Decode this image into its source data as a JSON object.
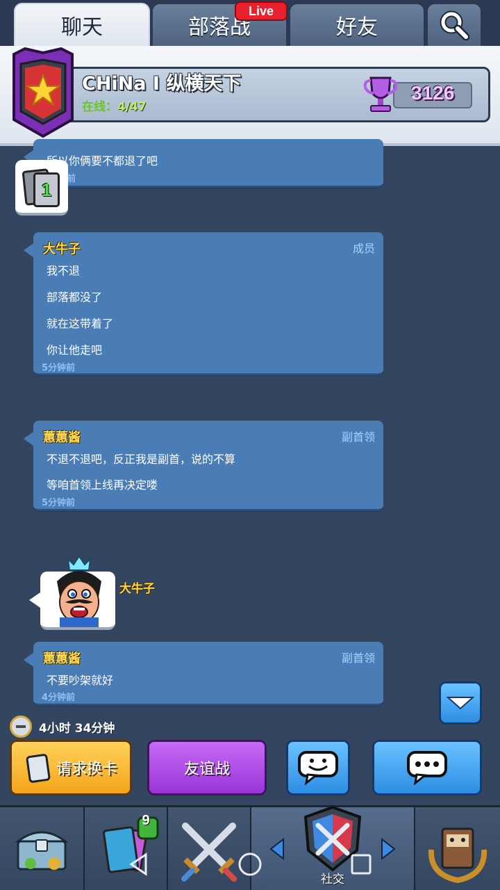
{
  "tabs": [
    {
      "label": "聊天",
      "active": true
    },
    {
      "label": "部落战",
      "active": false
    },
    {
      "label": "好友",
      "active": false
    }
  ],
  "live_badge": "Live",
  "clan": {
    "name": "CHiNa I 纵横天下",
    "online_label": "在线：",
    "online_value": "4/47",
    "trophies": "3126"
  },
  "level_badge": "1",
  "messages": [
    {
      "text": "所以你俩要不都退了吧",
      "time": "前"
    },
    {
      "sender": "大牛子",
      "role": "成员",
      "lines": [
        "我不退",
        "部落都没了",
        "就在这带着了",
        "你让他走吧"
      ],
      "time": "5分钟前"
    },
    {
      "sender": "蕙蕙酱",
      "role": "副首领",
      "lines": [
        "不退不退吧，反正我是副首，说的不算",
        "等咱首领上线再决定喽"
      ],
      "time": "5分钟前"
    },
    {
      "emote_sender": "大牛子"
    },
    {
      "sender": "蕙蕙酱",
      "role": "副首领",
      "lines": [
        "不要吵架就好"
      ],
      "time": "4分钟前"
    }
  ],
  "timer": "4小时 34分钟",
  "actions": {
    "request": "请求换卡",
    "friendly": "友谊战"
  },
  "nav": {
    "cards_badge": "9",
    "social_label": "社交"
  },
  "colors": {
    "bubble": "#4a7cb5",
    "background": "#34465f",
    "sender_name": "#ffd84a",
    "role": "#a9d4ff"
  }
}
